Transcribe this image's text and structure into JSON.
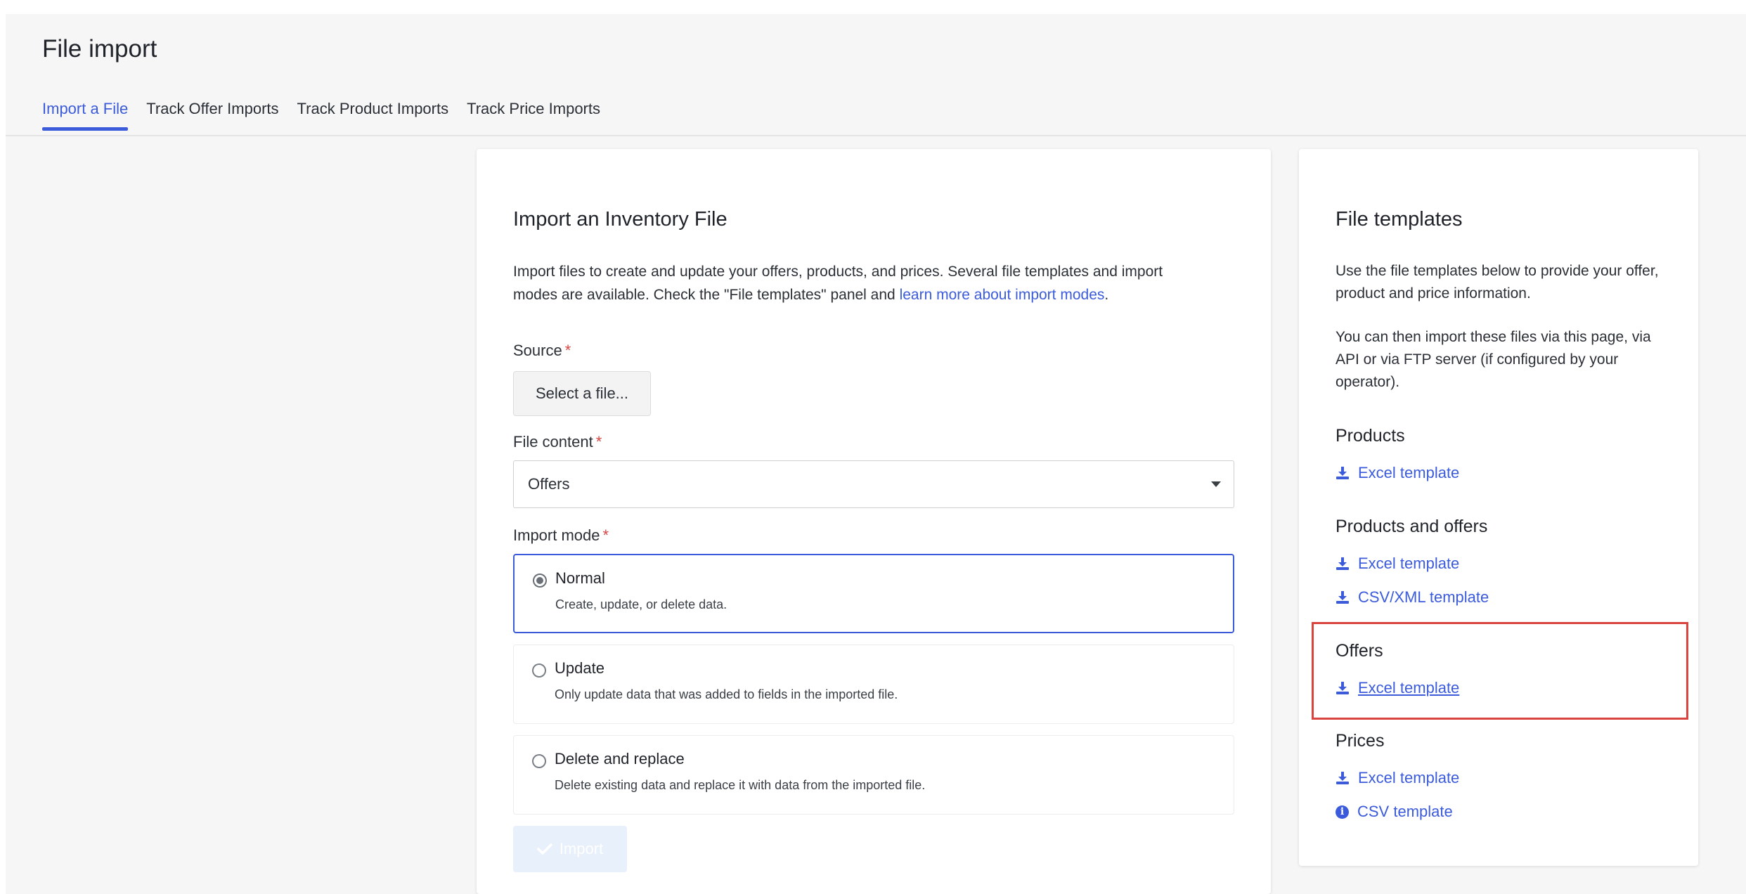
{
  "page": {
    "title": "File import"
  },
  "tabs": [
    {
      "label": "Import a File"
    },
    {
      "label": "Track Offer Imports"
    },
    {
      "label": "Track Product Imports"
    },
    {
      "label": "Track Price Imports"
    }
  ],
  "main": {
    "heading": "Import an Inventory File",
    "description_1": "Import files to create and update your offers, products, and prices. Several file templates and import",
    "description_2_prefix": "modes are available. Check the \"File templates\" panel and ",
    "description_link": "learn more about import modes",
    "description_2_suffix": ".",
    "source_label": "Source",
    "required_mark": "*",
    "select_file_label": "Select a file...",
    "file_content_label": "File content",
    "file_content_value": "Offers",
    "import_mode_label": "Import mode",
    "modes": [
      {
        "title": "Normal",
        "desc": "Create, update, or delete data."
      },
      {
        "title": "Update",
        "desc": "Only update data that was added to fields in the imported file."
      },
      {
        "title": "Delete and replace",
        "desc": "Delete existing data and replace it with data from the imported file."
      }
    ],
    "selected_mode": "Normal",
    "import_button": "Import"
  },
  "side": {
    "heading": "File templates",
    "desc_1": "Use the file templates below to provide your offer, product and price information.",
    "desc_2": "You can then import these files via this page, via API or via FTP server (if configured by your operator).",
    "sections": {
      "products": {
        "title": "Products",
        "links": [
          "Excel template"
        ]
      },
      "products_offers": {
        "title": "Products and offers",
        "links": [
          "Excel template",
          "CSV/XML template"
        ]
      },
      "offers": {
        "title": "Offers",
        "links": [
          "Excel template"
        ]
      },
      "prices": {
        "title": "Prices",
        "links": [
          "Excel template",
          "CSV template"
        ]
      }
    }
  },
  "colors": {
    "accent": "#3b5bdb",
    "required": "#d64541",
    "highlight": "#d9443f"
  },
  "icons": {
    "download": "download-icon",
    "info": "info-icon",
    "check": "check-icon",
    "caret": "chevron-down-icon"
  }
}
